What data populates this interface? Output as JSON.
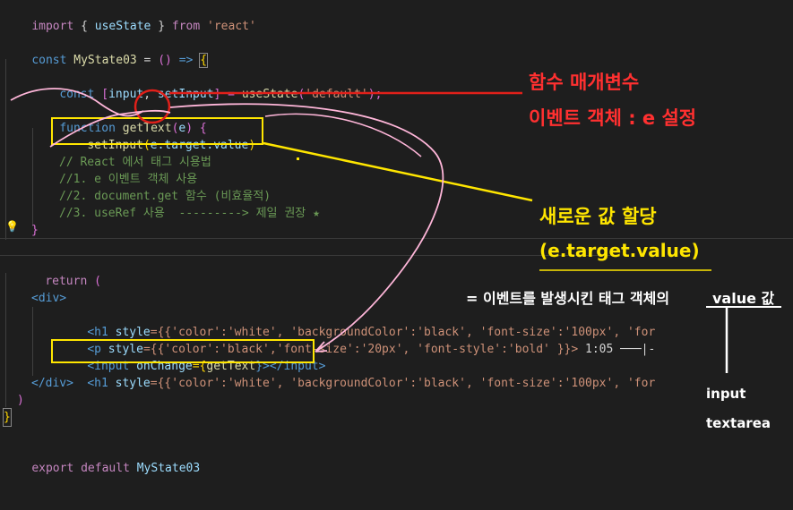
{
  "editor": {
    "lines": {
      "l1": {
        "kw": "import",
        "open": " { ",
        "name": "useState",
        "close": " } ",
        "from": "from",
        "space": " ",
        "src": "'react'"
      },
      "l3": {
        "kw": "const",
        "name": " MyState03",
        "eq": " = ",
        "parens": "()",
        "arrow": " => ",
        "brace": "{"
      },
      "l4": {
        "kw": "const",
        "open": " [",
        "a": "input",
        "comma": ", ",
        "b": "setInput",
        "close": "] = ",
        "fn": "useState",
        "p1": "(",
        "s": "'default'",
        "p2": ");"
      },
      "l6": {
        "kw": "function",
        "name": " getText",
        "p1": "(",
        "arg": "e",
        "p2": ")",
        "brace": " {"
      },
      "l7": {
        "fn": "setInput",
        "p1": "(",
        "v": "e.target.value",
        "p2": ")"
      },
      "c1": "// React 에서 태그 시용법",
      "c2": "//1. e 이벤트 객체 사용",
      "c3": "//2. document.get 함수 (비효율적)",
      "c4": "//3. useRef 사용  ---------> 제일 권장 ★",
      "l12": "}",
      "l14": {
        "kw": "return",
        "p": " ("
      },
      "l16": "<div>",
      "l17": {
        "tag": "<h1",
        "attr": " style",
        "rest": "={{'color':'white', 'backgroundColor':'black', 'font-size':'100px', 'for"
      },
      "l18": {
        "tag": "<p",
        "attr": " style",
        "rest": "={{'color':'black','font-size':'20px', 'font-style':'bold' }}>",
        "tail": " 1:05 ───|-"
      },
      "l19": {
        "tag": "<input",
        "attr": " onChange",
        "eq": "={",
        "fn": "getText",
        "close": "}></input>"
      },
      "l20": {
        "tag": "<h1",
        "attr": " style",
        "rest": "={{'color':'white', 'backgroundColor':'black', 'font-size':'100px', 'for"
      },
      "l21": "</div>",
      "l22": ")",
      "l23": "}",
      "l25": {
        "kw": "export",
        "kw2": " default",
        "name": " MyState03"
      }
    }
  },
  "annotations": {
    "param_title": "함수 매개변수",
    "event_object": "이벤트 객체 : e 설정",
    "assign_value": "새로운 값 할당",
    "target_value": "(e.target.value)",
    "definition": "= 이벤트를 발생시킨 태그 객체의",
    "value_label": "value 값",
    "input_label": "input",
    "textarea_label": "textarea"
  },
  "colors": {
    "background": "#1e1e1e",
    "annotation_red": "#ff3030",
    "annotation_yellow": "#ffe600",
    "annotation_pink": "#ffb6d9",
    "annotation_white": "#ffffff"
  },
  "icons": {
    "lightbulb": "lightbulb-icon"
  }
}
